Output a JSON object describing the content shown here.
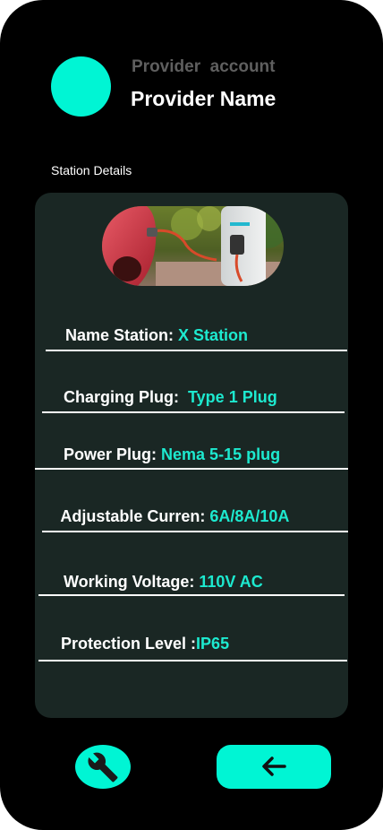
{
  "header": {
    "account_label": "Provider  account",
    "provider_name": "Provider Name"
  },
  "section": {
    "title": "Station Details"
  },
  "station": {
    "image_alt": "EV charging station plugged into red car"
  },
  "details": [
    {
      "label": "Name Station: ",
      "value": "X Station"
    },
    {
      "label": "Charging Plug:  ",
      "value": "Type 1 Plug"
    },
    {
      "label": "Power Plug: ",
      "value": "Nema 5-15 plug"
    },
    {
      "label": "Adjustable Curren: ",
      "value": "6A/8A/10A"
    },
    {
      "label": "Working Voltage: ",
      "value": "110V AC"
    },
    {
      "label": "Protection Level :",
      "value": "IP65"
    }
  ],
  "actions": {
    "settings_icon": "wrench-icon",
    "back_icon": "arrow-left-icon"
  },
  "colors": {
    "accent": "#00f5d4",
    "value_text": "#1de9cf",
    "card_bg": "#1a2724",
    "muted_text": "#5f5f5f"
  }
}
